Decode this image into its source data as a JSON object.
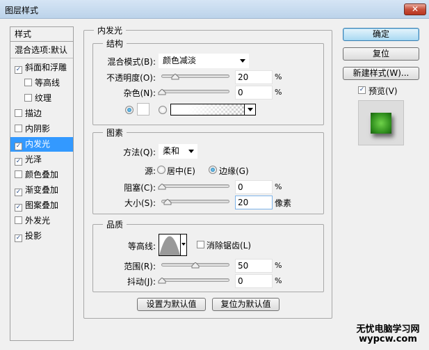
{
  "window": {
    "title": "图层样式",
    "close_label": "✕"
  },
  "sidebar": {
    "header": "样式",
    "blend_options": "混合选项:默认",
    "items": [
      {
        "label": "斜面和浮雕",
        "checked": true,
        "sub": false
      },
      {
        "label": "等高线",
        "checked": false,
        "sub": true
      },
      {
        "label": "纹理",
        "checked": false,
        "sub": true
      },
      {
        "label": "描边",
        "checked": false,
        "sub": false
      },
      {
        "label": "内阴影",
        "checked": false,
        "sub": false
      },
      {
        "label": "内发光",
        "checked": true,
        "sub": false,
        "selected": true
      },
      {
        "label": "光泽",
        "checked": true,
        "sub": false
      },
      {
        "label": "颜色叠加",
        "checked": false,
        "sub": false
      },
      {
        "label": "渐变叠加",
        "checked": true,
        "sub": false
      },
      {
        "label": "图案叠加",
        "checked": true,
        "sub": false
      },
      {
        "label": "外发光",
        "checked": false,
        "sub": false
      },
      {
        "label": "投影",
        "checked": true,
        "sub": false
      }
    ]
  },
  "panel": {
    "title": "内发光",
    "structure": {
      "title": "结构",
      "blend_mode_label": "混合模式(B):",
      "blend_mode": "颜色减淡",
      "opacity_label": "不透明度(O):",
      "opacity": "20",
      "opacity_unit": "%",
      "opacity_value": 20,
      "noise_label": "杂色(N):",
      "noise": "0",
      "noise_unit": "%",
      "noise_value": 0,
      "color_mode": "solid",
      "color": "#ffffff"
    },
    "elements": {
      "title": "图素",
      "technique_label": "方法(Q):",
      "technique": "柔和",
      "source_label": "源:",
      "source_center": "居中(E)",
      "source_edge": "边缘(G)",
      "source_selected": "edge",
      "choke_label": "阻塞(C):",
      "choke": "0",
      "choke_unit": "%",
      "choke_value": 0,
      "size_label": "大小(S):",
      "size": "20",
      "size_unit": "像素",
      "size_value": 20
    },
    "quality": {
      "title": "品质",
      "contour_label": "等高线:",
      "antialias_label": "消除锯齿(L)",
      "antialias": false,
      "range_label": "范围(R):",
      "range": "50",
      "range_unit": "%",
      "range_value": 50,
      "jitter_label": "抖动(J):",
      "jitter": "0",
      "jitter_unit": "%",
      "jitter_value": 0
    },
    "make_default": "设置为默认值",
    "reset_default": "复位为默认值"
  },
  "actions": {
    "ok": "确定",
    "reset": "复位",
    "new_style": "新建样式(W)...",
    "preview_label": "预览(V)",
    "preview": true
  },
  "watermark": {
    "line1": "无忧电脑学习网",
    "line2": "wypcw.com"
  }
}
